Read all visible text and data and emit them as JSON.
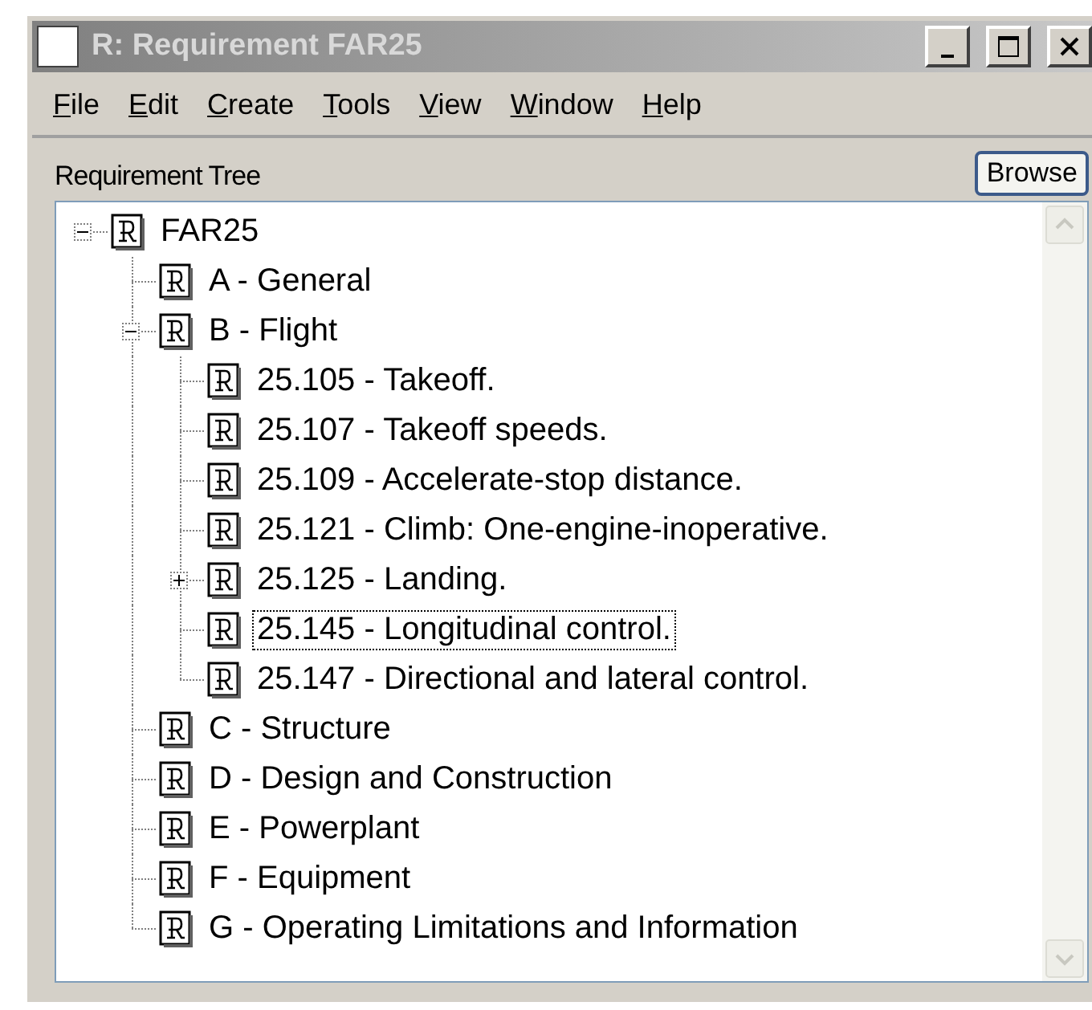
{
  "window": {
    "title": "R: Requirement FAR25"
  },
  "menu": [
    "File",
    "Edit",
    "Create",
    "Tools",
    "View",
    "Window",
    "Help"
  ],
  "panel": {
    "label": "Requirement Tree",
    "button": "Browse"
  },
  "tree": [
    {
      "label": "FAR25",
      "expanded": true,
      "selected": false,
      "children": [
        {
          "label": "A - General",
          "selected": false
        },
        {
          "label": "B - Flight",
          "expanded": true,
          "selected": false,
          "children": [
            {
              "label": "25.105 - Takeoff.",
              "selected": false
            },
            {
              "label": "25.107 - Takeoff speeds.",
              "selected": false
            },
            {
              "label": "25.109 - Accelerate-stop distance.",
              "selected": false
            },
            {
              "label": "25.121 - Climb: One-engine-inoperative.",
              "selected": false
            },
            {
              "label": "25.125 - Landing.",
              "expanded": false,
              "selected": false
            },
            {
              "label": "25.145 - Longitudinal control.",
              "selected": true
            },
            {
              "label": "25.147 - Directional and lateral control.",
              "selected": false
            }
          ]
        },
        {
          "label": "C - Structure",
          "selected": false
        },
        {
          "label": "D - Design and Construction",
          "selected": false
        },
        {
          "label": "E - Powerplant",
          "selected": false
        },
        {
          "label": "F - Equipment",
          "selected": false
        },
        {
          "label": "G - Operating Limitations and Information",
          "selected": false
        }
      ]
    }
  ]
}
